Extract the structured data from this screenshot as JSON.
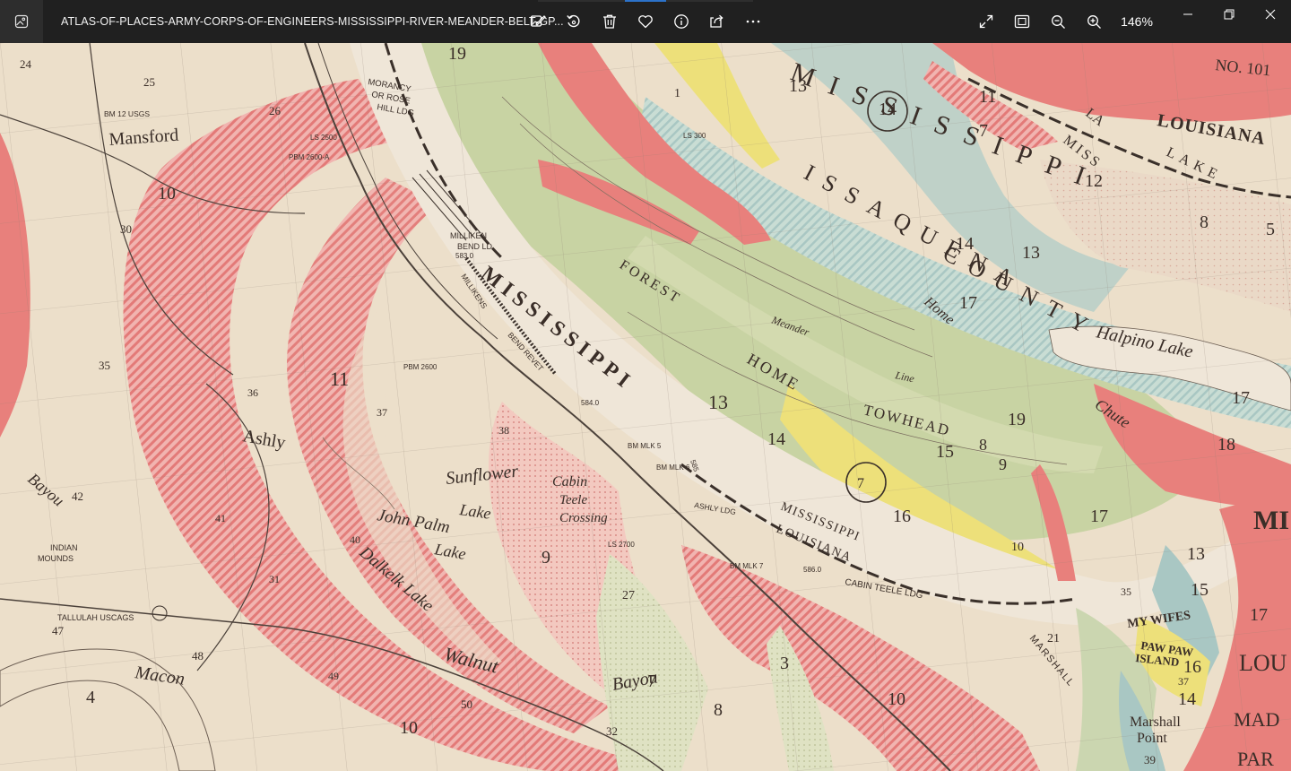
{
  "window": {
    "file_name": "ATLAS-OF-PLACES-ARMY-CORPS-OF-ENGINEERS-MISSISSIPPI-RIVER-MEANDER-BELT-GP...",
    "zoom_level": "146%"
  },
  "toolbar": {
    "icons": [
      "edit-image-icon",
      "rotate-icon",
      "delete-icon",
      "favorite-icon",
      "info-icon",
      "share-icon",
      "more-icon"
    ]
  },
  "view_controls": {
    "icons": [
      "fullscreen-icon",
      "fit-window-icon",
      "zoom-out-icon",
      "zoom-in-icon"
    ]
  },
  "window_controls": {
    "icons": [
      "minimize-icon",
      "restore-icon",
      "close-icon"
    ]
  },
  "map": {
    "river_labels": [
      "MISSISSIPPI",
      "MISSISSIPPI",
      "LOUISIANA"
    ],
    "region_labels": [
      "MISSISSIPPI",
      "ISSAQUENA",
      "COUNTY",
      "LOUISIANA",
      "MISS",
      "LAKE",
      "LA",
      "NO. 101",
      "MI",
      "LOU",
      "MAD",
      "PAR"
    ],
    "place_labels": [
      "Mansford",
      "Ashly",
      "Macon",
      "Sunflower",
      "Lake",
      "John Palm",
      "Lake",
      "Dalkelk Lake",
      "Walnut",
      "Bayou",
      "Bayou",
      "Halpino Lake",
      "Meander",
      "Line",
      "Home",
      "Chute",
      "TOWHEAD",
      "HOME",
      "FOREST",
      "Marshall",
      "Point",
      "MY WIFES",
      "PAW PAW",
      "ISLAND",
      "Cabin",
      "Teele",
      "Crossing",
      "INDIAN",
      "MOUNDS"
    ],
    "landing_labels": [
      "MORANCY",
      "OR ROSE",
      "HILL LDG",
      "MILLIKEN",
      "BEND LD",
      "MILLIKENS",
      "BEND REVET",
      "ASHLY LDG",
      "CABIN TEELE LDG",
      "MARSHALL",
      "TALLULAH USCAGS",
      "BM 12 USGS",
      "BM MLK 5",
      "BM MLK 6",
      "BM MLK 7",
      "LS 2500",
      "PBM 2600",
      "LS 2700",
      "PBM 2600-A",
      "LS 300",
      "584.0",
      "585",
      "586.0",
      "583.0"
    ],
    "section_numbers": [
      "19",
      "24",
      "25",
      "26",
      "10",
      "30",
      "35",
      "11",
      "36",
      "37",
      "38",
      "42",
      "41",
      "40",
      "47",
      "48",
      "49",
      "50",
      "4",
      "10",
      "9",
      "13",
      "14",
      "15",
      "16",
      "17",
      "18",
      "19",
      "12",
      "13",
      "14",
      "17",
      "11",
      "7",
      "8",
      "5",
      "27",
      "31",
      "32",
      "3",
      "7",
      "8",
      "10",
      "21",
      "39",
      "35",
      "37",
      "16",
      "14",
      "15",
      "17",
      "13",
      "7",
      "8",
      "9",
      "10",
      "1",
      "13",
      "14",
      "17"
    ]
  }
}
